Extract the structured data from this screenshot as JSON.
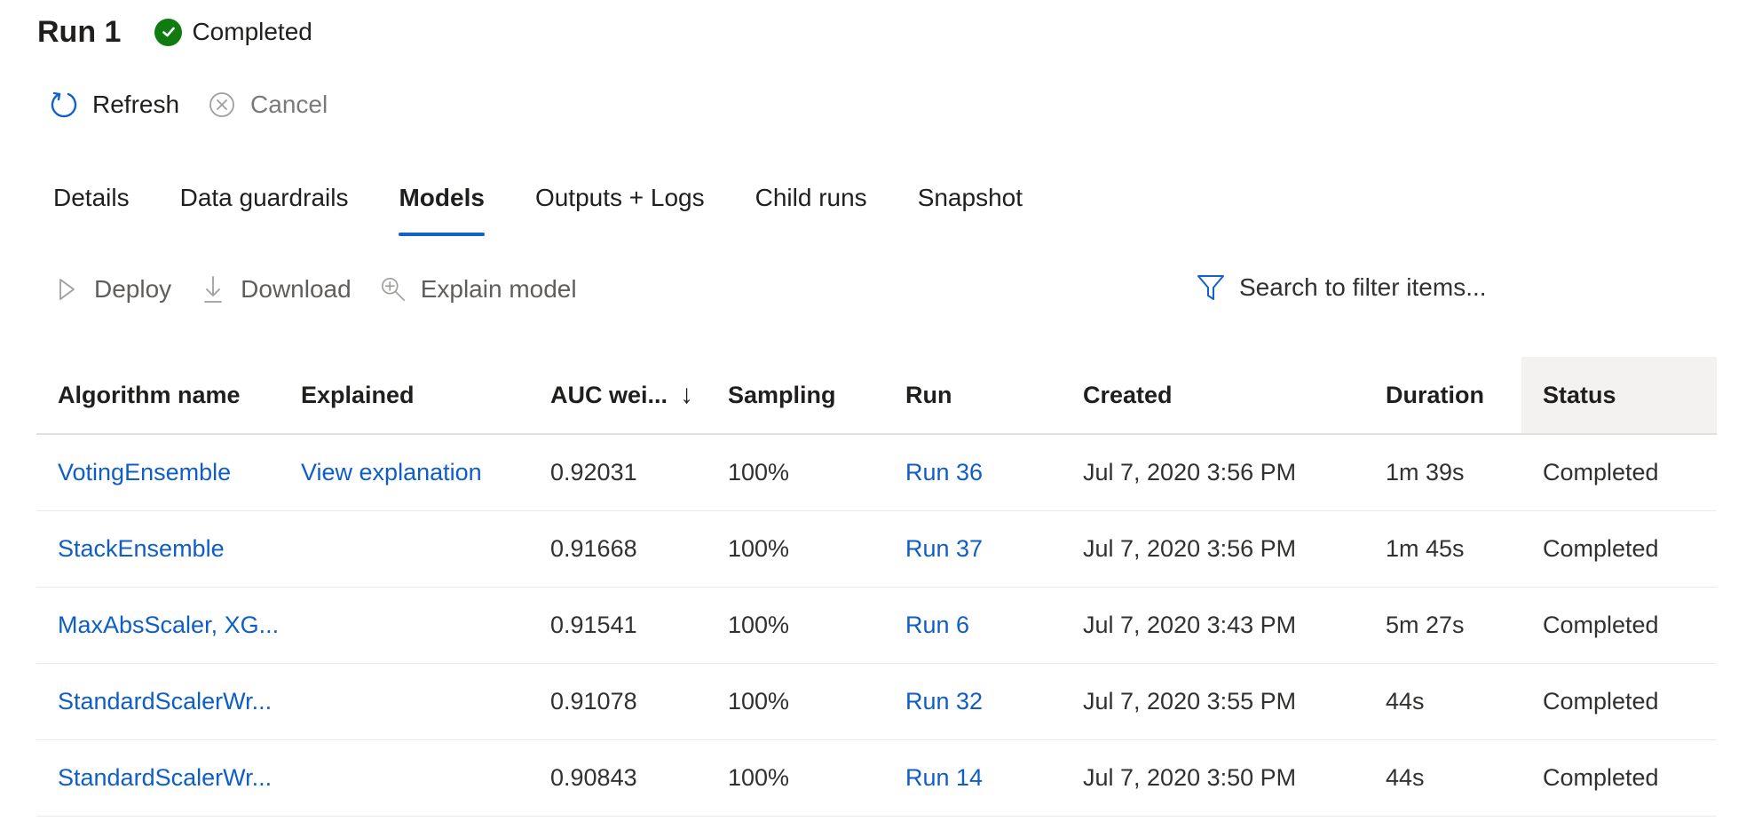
{
  "header": {
    "title": "Run 1",
    "status": "Completed",
    "status_color": "#107c10"
  },
  "commands": {
    "refresh": "Refresh",
    "cancel": "Cancel"
  },
  "tabs": [
    {
      "label": "Details",
      "active": false
    },
    {
      "label": "Data guardrails",
      "active": false
    },
    {
      "label": "Models",
      "active": true
    },
    {
      "label": "Outputs + Logs",
      "active": false
    },
    {
      "label": "Child runs",
      "active": false
    },
    {
      "label": "Snapshot",
      "active": false
    }
  ],
  "toolbar": {
    "deploy": "Deploy",
    "download": "Download",
    "explain": "Explain model"
  },
  "search": {
    "placeholder": "Search to filter items..."
  },
  "table": {
    "columns": [
      "Algorithm name",
      "Explained",
      "AUC wei...",
      "Sampling",
      "Run",
      "Created",
      "Duration",
      "Status"
    ],
    "sort_indicator": "↓",
    "rows": [
      {
        "algorithm": "VotingEnsemble",
        "explained": "View explanation",
        "auc": "0.92031",
        "sampling": "100%",
        "run": "Run 36",
        "created": "Jul 7, 2020 3:56 PM",
        "duration": "1m 39s",
        "status": "Completed"
      },
      {
        "algorithm": "StackEnsemble",
        "explained": "",
        "auc": "0.91668",
        "sampling": "100%",
        "run": "Run 37",
        "created": "Jul 7, 2020 3:56 PM",
        "duration": "1m 45s",
        "status": "Completed"
      },
      {
        "algorithm": "MaxAbsScaler, XG...",
        "explained": "",
        "auc": "0.91541",
        "sampling": "100%",
        "run": "Run 6",
        "created": "Jul 7, 2020 3:43 PM",
        "duration": "5m 27s",
        "status": "Completed"
      },
      {
        "algorithm": "StandardScalerWr...",
        "explained": "",
        "auc": "0.91078",
        "sampling": "100%",
        "run": "Run 32",
        "created": "Jul 7, 2020 3:55 PM",
        "duration": "44s",
        "status": "Completed"
      },
      {
        "algorithm": "StandardScalerWr...",
        "explained": "",
        "auc": "0.90843",
        "sampling": "100%",
        "run": "Run 14",
        "created": "Jul 7, 2020 3:50 PM",
        "duration": "44s",
        "status": "Completed"
      }
    ]
  }
}
